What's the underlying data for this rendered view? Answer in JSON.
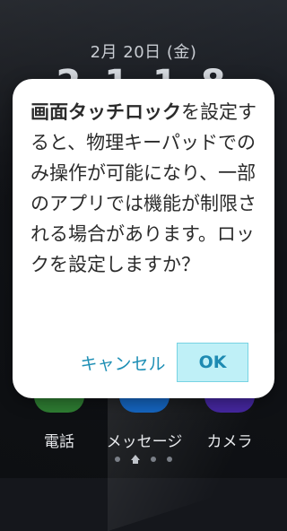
{
  "lockscreen": {
    "date": "2月 20日 (金)",
    "clock_peek": "2 1 1 8",
    "dock": [
      {
        "label": "電話",
        "icon": "phone-icon"
      },
      {
        "label": "メッセージ",
        "icon": "message-icon"
      },
      {
        "label": "カメラ",
        "icon": "camera-icon"
      }
    ],
    "pager_pages": 4,
    "pager_home_index": 1
  },
  "dialog": {
    "message_bold": "画面タッチロック",
    "message_rest": "を設定すると、物理キーパッドでのみ操作が可能になり、一部のアプリでは機能が制限される場合があります。ロックを設定しますか？",
    "cancel_label": "キャンセル",
    "ok_label": "OK"
  },
  "colors": {
    "accent": "#1e8fb5",
    "ok_bg": "#bff0f7",
    "dialog_bg": "#ffffff"
  }
}
